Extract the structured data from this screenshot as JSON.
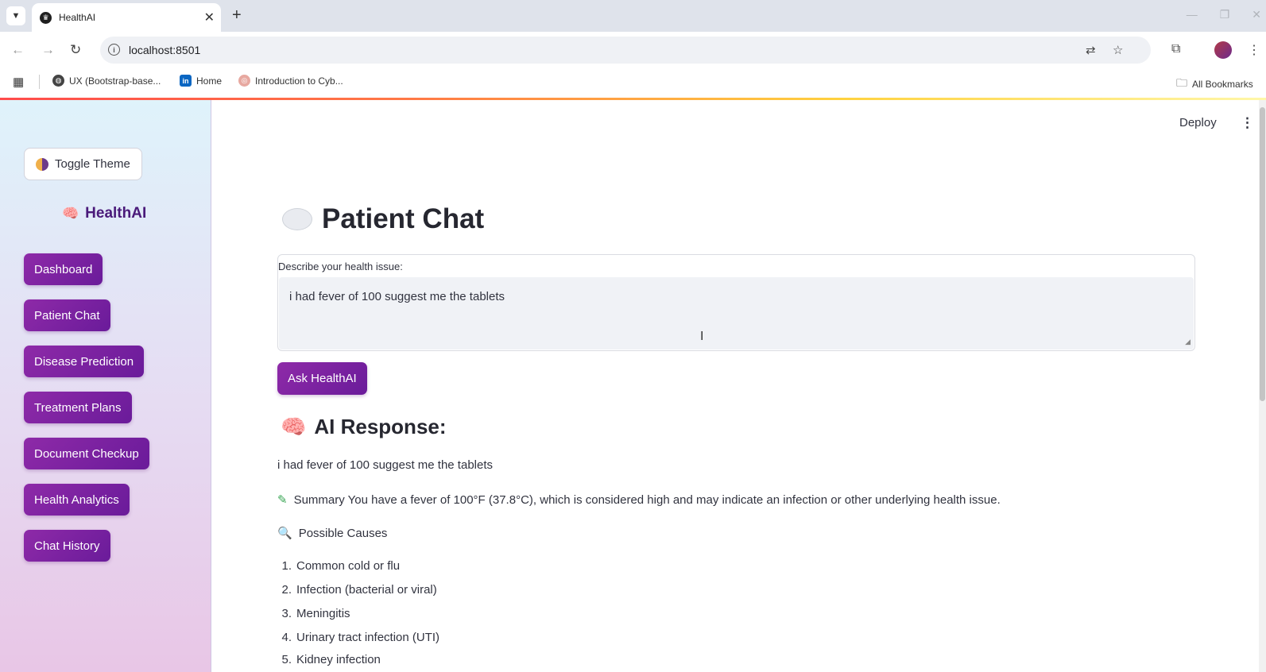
{
  "browser": {
    "tab_title": "HealthAI",
    "url": "localhost:8501",
    "bookmarks": [
      "UX (Bootstrap-base...",
      "Home",
      "Introduction to Cyb..."
    ],
    "all_bookmarks": "All Bookmarks"
  },
  "sidebar": {
    "toggle_theme": "Toggle Theme",
    "brand": "HealthAI",
    "nav": [
      "Dashboard",
      "Patient Chat",
      "Disease Prediction",
      "Treatment Plans",
      "Document Checkup",
      "Health Analytics",
      "Chat History"
    ]
  },
  "header": {
    "deploy": "Deploy"
  },
  "main": {
    "title": "Patient Chat",
    "input_label": "Describe your health issue:",
    "input_value": "i had fever of 100 suggest me the tablets",
    "ask_button": "Ask HealthAI",
    "response_title": "AI Response:",
    "response_echo": "i had fever of 100 suggest me the tablets",
    "summary": "Summary You have a fever of 100°F (37.8°C), which is considered high and may indicate an infection or other underlying health issue.",
    "causes_heading": "Possible Causes",
    "causes": [
      {
        "num": "1.",
        "text": "Common cold or flu"
      },
      {
        "num": "2.",
        "text": "Infection (bacterial or viral)"
      },
      {
        "num": "3.",
        "text": "Meningitis"
      },
      {
        "num": "4.",
        "text": "Urinary tract infection (UTI)"
      },
      {
        "num": "5.",
        "text": "Kidney infection"
      }
    ]
  },
  "colors": {
    "accent": "#7b1fa2",
    "sidebar_top": "#dff3fb",
    "sidebar_bottom": "#e8c6e6"
  }
}
